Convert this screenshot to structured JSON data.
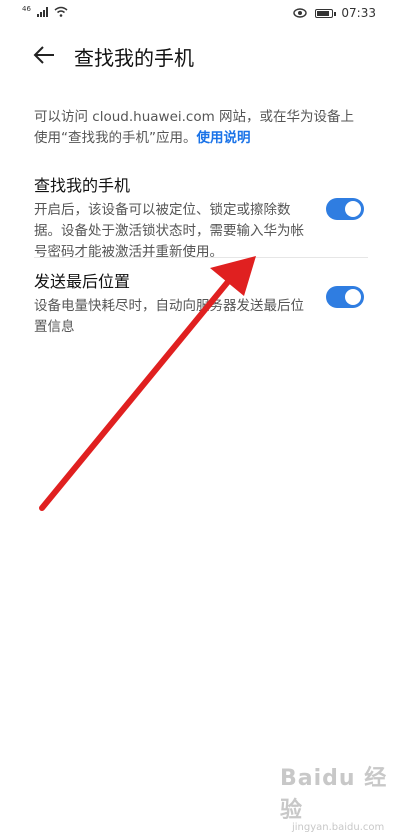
{
  "status_bar": {
    "network_label": "46",
    "time": "07:33"
  },
  "header": {
    "title": "查找我的手机"
  },
  "description": {
    "text": "可以访问 cloud.huawei.com 网站，或在华为设备上使用“查找我的手机”应用。",
    "link": "使用说明"
  },
  "settings": [
    {
      "title": "查找我的手机",
      "subtitle": "开启后，该设备可以被定位、锁定或擦除数据。设备处于激活锁状态时，需要输入华为帐号密码才能被激活并重新使用。",
      "enabled": true
    },
    {
      "title": "发送最后位置",
      "subtitle": "设备电量快耗尽时，自动向服务器发送最后位置信息",
      "enabled": true
    }
  ],
  "colors": {
    "accent": "#2f7de1",
    "link": "#1a73e8",
    "annotation_arrow": "#e02020"
  },
  "watermark": {
    "main": "Baidu 经验",
    "sub": "jingyan.baidu.com"
  }
}
